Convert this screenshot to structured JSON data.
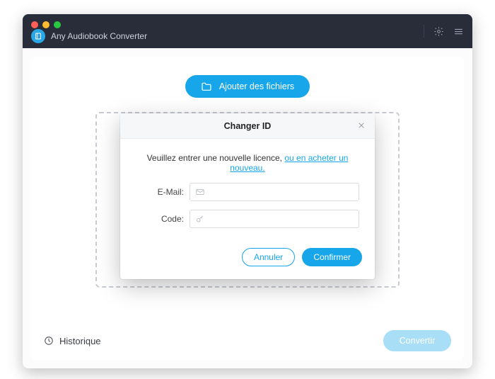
{
  "app": {
    "title": "Any Audiobook Converter"
  },
  "toolbar": {
    "add_label": "Ajouter des fichiers"
  },
  "footer": {
    "history_label": "Historique",
    "convert_label": "Convertir"
  },
  "modal": {
    "title": "Changer ID",
    "message_prefix": "Veuillez entrer une nouvelle licence, ",
    "message_link": "ou en acheter un nouveau.",
    "email_label": "E-Mail:",
    "code_label": "Code:",
    "email_value": "",
    "code_value": "",
    "cancel_label": "Annuler",
    "confirm_label": "Confirmer"
  }
}
